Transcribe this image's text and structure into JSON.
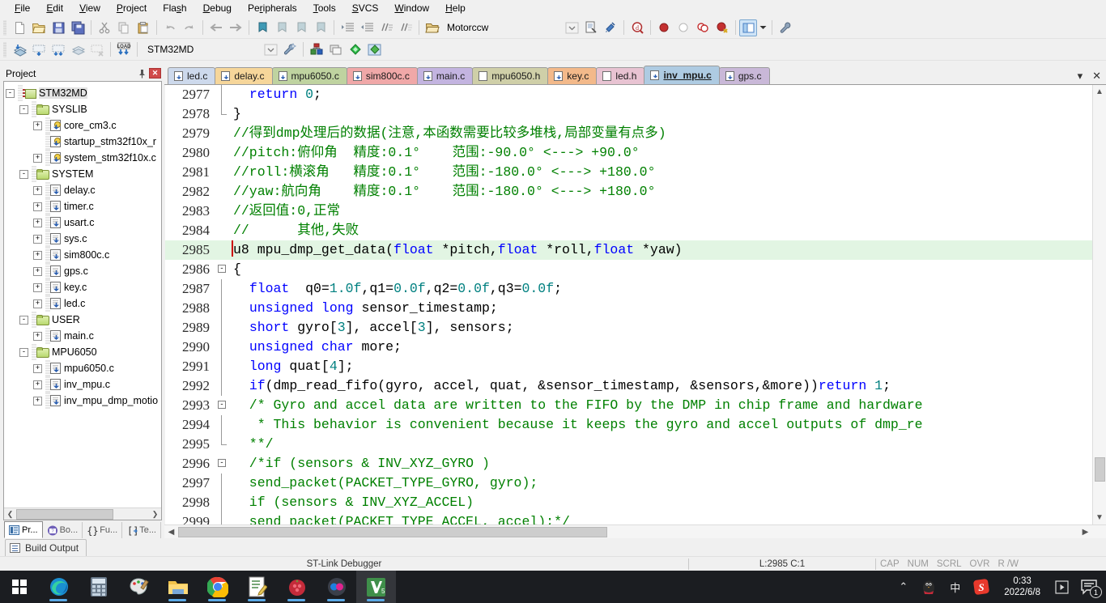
{
  "menubar": {
    "items": [
      {
        "label": "File",
        "accel": "F"
      },
      {
        "label": "Edit",
        "accel": "E"
      },
      {
        "label": "View",
        "accel": "V"
      },
      {
        "label": "Project",
        "accel": "P"
      },
      {
        "label": "Flash",
        "accel": "s"
      },
      {
        "label": "Debug",
        "accel": "D"
      },
      {
        "label": "Peripherals",
        "accel": "r"
      },
      {
        "label": "Tools",
        "accel": "T"
      },
      {
        "label": "SVCS",
        "accel": "S"
      },
      {
        "label": "Window",
        "accel": "W"
      },
      {
        "label": "Help",
        "accel": "H"
      }
    ]
  },
  "toolbar_main": {
    "icons": [
      "new-file-icon",
      "open-file-icon",
      "save-icon",
      "save-all-icon",
      "cut-icon",
      "copy-icon",
      "paste-icon",
      "undo-icon",
      "redo-icon",
      "navigate-back-icon",
      "navigate-forward-icon",
      "bookmark-toggle-icon",
      "bookmark-prev-icon",
      "bookmark-next-icon",
      "bookmark-clear-icon",
      "indent-icon",
      "outdent-icon",
      "comment-icon",
      "uncomment-icon"
    ]
  },
  "toolbar_build": {
    "icons": [
      "translate-icon",
      "build-icon",
      "rebuild-icon",
      "batch-build-icon",
      "stop-build-icon",
      "download-icon"
    ],
    "target_value": "STM32MD",
    "target_dropdown": "chevron-down-icon",
    "after_icons": [
      "target-options-icon",
      "manage-runtime-icon",
      "debug-start-icon",
      "window-layout-icon",
      "configuration-icon"
    ]
  },
  "toolbar_debug": {
    "search_value": "Motorccw",
    "search_dropdown": "chevron-down-icon",
    "icons": [
      "browse-symbols-icon",
      "find-in-files-icon",
      "insert-bookmark-icon"
    ],
    "breakpoint_icons": [
      "insert-breakpoint-icon",
      "disable-breakpoint-icon",
      "disable-all-breakpoints-icon",
      "kill-all-breakpoints-icon"
    ],
    "layout_icon": "window-layout-icon",
    "layout_dropdown": "chevron-down-icon",
    "tools_icon": "configure-icon"
  },
  "project_pane": {
    "title": "Project",
    "pin_icon": "pin-icon",
    "close_icon": "close-icon",
    "tree": [
      {
        "label": "STM32MD",
        "icon": "target-icon",
        "depth": 0,
        "expander": "-",
        "selected": true
      },
      {
        "label": "SYSLIB",
        "icon": "folder-green-icon",
        "depth": 1,
        "expander": "-"
      },
      {
        "label": "core_cm3.c",
        "icon": "file-key-icon",
        "depth": 2,
        "expander": "+"
      },
      {
        "label": "startup_stm32f10x_r",
        "icon": "file-key-icon",
        "depth": 2,
        "expander": ""
      },
      {
        "label": "system_stm32f10x.c",
        "icon": "file-key-icon",
        "depth": 2,
        "expander": "+"
      },
      {
        "label": "SYSTEM",
        "icon": "folder-green-icon",
        "depth": 1,
        "expander": "-"
      },
      {
        "label": "delay.c",
        "icon": "file-c-icon",
        "depth": 2,
        "expander": "+"
      },
      {
        "label": "timer.c",
        "icon": "file-c-icon",
        "depth": 2,
        "expander": "+"
      },
      {
        "label": "usart.c",
        "icon": "file-c-icon",
        "depth": 2,
        "expander": "+"
      },
      {
        "label": "sys.c",
        "icon": "file-c-icon",
        "depth": 2,
        "expander": "+"
      },
      {
        "label": "sim800c.c",
        "icon": "file-c-icon",
        "depth": 2,
        "expander": "+"
      },
      {
        "label": "gps.c",
        "icon": "file-c-icon",
        "depth": 2,
        "expander": "+"
      },
      {
        "label": "key.c",
        "icon": "file-c-icon",
        "depth": 2,
        "expander": "+"
      },
      {
        "label": "led.c",
        "icon": "file-c-icon",
        "depth": 2,
        "expander": "+"
      },
      {
        "label": "USER",
        "icon": "folder-green-icon",
        "depth": 1,
        "expander": "-"
      },
      {
        "label": "main.c",
        "icon": "file-c-icon",
        "depth": 2,
        "expander": "+"
      },
      {
        "label": "MPU6050",
        "icon": "folder-green-icon",
        "depth": 1,
        "expander": "-"
      },
      {
        "label": "mpu6050.c",
        "icon": "file-c-icon",
        "depth": 2,
        "expander": "+"
      },
      {
        "label": "inv_mpu.c",
        "icon": "file-c-icon",
        "depth": 2,
        "expander": "+"
      },
      {
        "label": "inv_mpu_dmp_motio",
        "icon": "file-c-icon",
        "depth": 2,
        "expander": "+"
      }
    ],
    "bottom_tabs": [
      {
        "label": "Pr...",
        "icon": "project-icon",
        "active": true
      },
      {
        "label": "Bo...",
        "icon": "books-icon",
        "active": false
      },
      {
        "label": "Fu...",
        "icon": "functions-icon",
        "active": false
      },
      {
        "label": "Te...",
        "icon": "templates-icon",
        "active": false
      }
    ]
  },
  "editor": {
    "tabs": [
      {
        "label": "led.c",
        "color": "#cdd9ec",
        "icon": "c-file-icon",
        "active": false
      },
      {
        "label": "delay.c",
        "color": "#f6d69a",
        "icon": "c-file-icon",
        "active": false
      },
      {
        "label": "mpu6050.c",
        "color": "#bfd3a0",
        "icon": "c-file-icon",
        "active": false
      },
      {
        "label": "sim800c.c",
        "color": "#f0a8a8",
        "icon": "c-file-icon",
        "active": false
      },
      {
        "label": "main.c",
        "color": "#c3b4e0",
        "icon": "c-file-icon",
        "active": false
      },
      {
        "label": "mpu6050.h",
        "color": "#cfcfa8",
        "icon": "h-file-icon",
        "active": false
      },
      {
        "label": "key.c",
        "color": "#f3b98a",
        "icon": "c-file-icon",
        "active": false
      },
      {
        "label": "led.h",
        "color": "#e8c3d2",
        "icon": "h-file-icon",
        "active": false
      },
      {
        "label": "inv_mpu.c",
        "color": "#aecbe2",
        "icon": "c-file-icon",
        "active": true
      },
      {
        "label": "gps.c",
        "color": "#c9b8d8",
        "icon": "c-file-icon",
        "active": false
      }
    ],
    "tab_menu_icon": "chevron-down-icon",
    "tab_close_icon": "close-icon",
    "lines": [
      {
        "n": "2977",
        "fold": "bar-half-bot",
        "highlight": false,
        "tokens": [
          {
            "t": "  ",
            "c": "pl"
          },
          {
            "t": "return",
            "c": "kw"
          },
          {
            "t": " ",
            "c": "pl"
          },
          {
            "t": "0",
            "c": "num"
          },
          {
            "t": ";",
            "c": "pl"
          }
        ]
      },
      {
        "n": "2978",
        "fold": "end",
        "highlight": false,
        "tokens": [
          {
            "t": "}",
            "c": "pl"
          }
        ]
      },
      {
        "n": "2979",
        "fold": "none",
        "highlight": false,
        "tokens": [
          {
            "t": "//得到dmp处理后的数据(注意,本函数需要比较多堆栈,局部变量有点多)",
            "c": "cm"
          }
        ]
      },
      {
        "n": "2980",
        "fold": "none",
        "highlight": false,
        "tokens": [
          {
            "t": "//pitch:俯仰角  精度:0.1°    范围:-90.0° <---> +90.0°",
            "c": "cm"
          }
        ]
      },
      {
        "n": "2981",
        "fold": "none",
        "highlight": false,
        "tokens": [
          {
            "t": "//roll:横滚角   精度:0.1°    范围:-180.0° <---> +180.0°",
            "c": "cm"
          }
        ]
      },
      {
        "n": "2982",
        "fold": "none",
        "highlight": false,
        "tokens": [
          {
            "t": "//yaw:航向角    精度:0.1°    范围:-180.0° <---> +180.0°",
            "c": "cm"
          }
        ]
      },
      {
        "n": "2983",
        "fold": "none",
        "highlight": false,
        "tokens": [
          {
            "t": "//返回值:0,正常",
            "c": "cm"
          }
        ]
      },
      {
        "n": "2984",
        "fold": "none",
        "highlight": false,
        "tokens": [
          {
            "t": "//      其他,失败",
            "c": "cm"
          }
        ]
      },
      {
        "n": "2985",
        "fold": "none",
        "highlight": true,
        "caret": true,
        "tokens": [
          {
            "t": "u8 mpu_dmp_get_data(",
            "c": "pl"
          },
          {
            "t": "float",
            "c": "kw"
          },
          {
            "t": " *pitch,",
            "c": "pl"
          },
          {
            "t": "float",
            "c": "kw"
          },
          {
            "t": " *roll,",
            "c": "pl"
          },
          {
            "t": "float",
            "c": "kw"
          },
          {
            "t": " *yaw)",
            "c": "pl"
          }
        ]
      },
      {
        "n": "2986",
        "fold": "start",
        "highlight": false,
        "tokens": [
          {
            "t": "{",
            "c": "pl"
          }
        ]
      },
      {
        "n": "2987",
        "fold": "bar",
        "highlight": false,
        "tokens": [
          {
            "t": "  ",
            "c": "pl"
          },
          {
            "t": "float",
            "c": "kw"
          },
          {
            "t": "  q0=",
            "c": "pl"
          },
          {
            "t": "1.0f",
            "c": "num"
          },
          {
            "t": ",q1=",
            "c": "pl"
          },
          {
            "t": "0.0f",
            "c": "num"
          },
          {
            "t": ",q2=",
            "c": "pl"
          },
          {
            "t": "0.0f",
            "c": "num"
          },
          {
            "t": ",q3=",
            "c": "pl"
          },
          {
            "t": "0.0f",
            "c": "num"
          },
          {
            "t": ";",
            "c": "pl"
          }
        ]
      },
      {
        "n": "2988",
        "fold": "bar",
        "highlight": false,
        "tokens": [
          {
            "t": "  ",
            "c": "pl"
          },
          {
            "t": "unsigned long",
            "c": "kw"
          },
          {
            "t": " sensor_timestamp;",
            "c": "pl"
          }
        ]
      },
      {
        "n": "2989",
        "fold": "bar",
        "highlight": false,
        "tokens": [
          {
            "t": "  ",
            "c": "pl"
          },
          {
            "t": "short",
            "c": "kw"
          },
          {
            "t": " gyro[",
            "c": "pl"
          },
          {
            "t": "3",
            "c": "num"
          },
          {
            "t": "], accel[",
            "c": "pl"
          },
          {
            "t": "3",
            "c": "num"
          },
          {
            "t": "], sensors;",
            "c": "pl"
          }
        ]
      },
      {
        "n": "2990",
        "fold": "bar",
        "highlight": false,
        "tokens": [
          {
            "t": "  ",
            "c": "pl"
          },
          {
            "t": "unsigned char",
            "c": "kw"
          },
          {
            "t": " more;",
            "c": "pl"
          }
        ]
      },
      {
        "n": "2991",
        "fold": "bar",
        "highlight": false,
        "tokens": [
          {
            "t": "  ",
            "c": "pl"
          },
          {
            "t": "long",
            "c": "kw"
          },
          {
            "t": " quat[",
            "c": "pl"
          },
          {
            "t": "4",
            "c": "num"
          },
          {
            "t": "];",
            "c": "pl"
          }
        ]
      },
      {
        "n": "2992",
        "fold": "bar",
        "highlight": false,
        "tokens": [
          {
            "t": "  ",
            "c": "pl"
          },
          {
            "t": "if",
            "c": "kw"
          },
          {
            "t": "(dmp_read_fifo(gyro, accel, quat, &sensor_timestamp, &sensors,&more))",
            "c": "pl"
          },
          {
            "t": "return",
            "c": "kw"
          },
          {
            "t": " ",
            "c": "pl"
          },
          {
            "t": "1",
            "c": "num"
          },
          {
            "t": ";",
            "c": "pl"
          }
        ]
      },
      {
        "n": "2993",
        "fold": "start",
        "highlight": false,
        "tokens": [
          {
            "t": "  /* Gyro and accel data are written to the FIFO by the DMP in chip frame and hardware",
            "c": "cm"
          }
        ]
      },
      {
        "n": "2994",
        "fold": "bar",
        "highlight": false,
        "tokens": [
          {
            "t": "   * This behavior is convenient because it keeps the gyro and accel outputs of dmp_re",
            "c": "cm"
          }
        ]
      },
      {
        "n": "2995",
        "fold": "end",
        "highlight": false,
        "tokens": [
          {
            "t": "  **/",
            "c": "cm"
          }
        ]
      },
      {
        "n": "2996",
        "fold": "start",
        "highlight": false,
        "tokens": [
          {
            "t": "  /*if (sensors & INV_XYZ_GYRO )",
            "c": "cm"
          }
        ]
      },
      {
        "n": "2997",
        "fold": "bar",
        "highlight": false,
        "tokens": [
          {
            "t": "  send_packet(PACKET_TYPE_GYRO, gyro);",
            "c": "cm"
          }
        ]
      },
      {
        "n": "2998",
        "fold": "bar",
        "highlight": false,
        "tokens": [
          {
            "t": "  if (sensors & INV_XYZ_ACCEL)",
            "c": "cm"
          }
        ]
      },
      {
        "n": "2999",
        "fold": "bar",
        "highlight": false,
        "tokens": [
          {
            "t": "  send_packet(PACKET_TYPE_ACCEL, accel);*/",
            "c": "cm"
          }
        ]
      }
    ],
    "scrollbar": {
      "up_icon": "chevron-up-icon",
      "down_icon": "chevron-down-icon",
      "left_icon": "chevron-left-icon",
      "right_icon": "chevron-right-icon"
    }
  },
  "build_output": {
    "tab_label": "Build Output",
    "icon": "output-window-icon"
  },
  "statusbar": {
    "debugger": "ST-Link Debugger",
    "position": "L:2985 C:1",
    "flags": [
      "CAP",
      "NUM",
      "SCRL",
      "OVR",
      "R /W"
    ]
  },
  "taskbar": {
    "start_icon": "windows-start-icon",
    "items": [
      {
        "name": "edge-icon",
        "running": true
      },
      {
        "name": "calculator-icon",
        "running": false
      },
      {
        "name": "paint-icon",
        "running": false
      },
      {
        "name": "file-explorer-icon",
        "running": true
      },
      {
        "name": "chrome-icon",
        "running": true
      },
      {
        "name": "notepad-icon",
        "running": true
      },
      {
        "name": "pomegranate-app-icon",
        "running": true
      },
      {
        "name": "flickr-app-icon",
        "running": true
      },
      {
        "name": "keil-uvision-icon",
        "running": true,
        "active": true
      }
    ],
    "tray": {
      "overflow_icon": "chevron-up-icon",
      "qq_icon": "qq-penguin-icon",
      "ime_label": "中",
      "sogou_icon": "sogou-icon",
      "time": "0:33",
      "date": "2022/6/8",
      "action_center_icon": "notification-icon",
      "notification_count": "1",
      "media_icon": "media-play-icon"
    }
  }
}
